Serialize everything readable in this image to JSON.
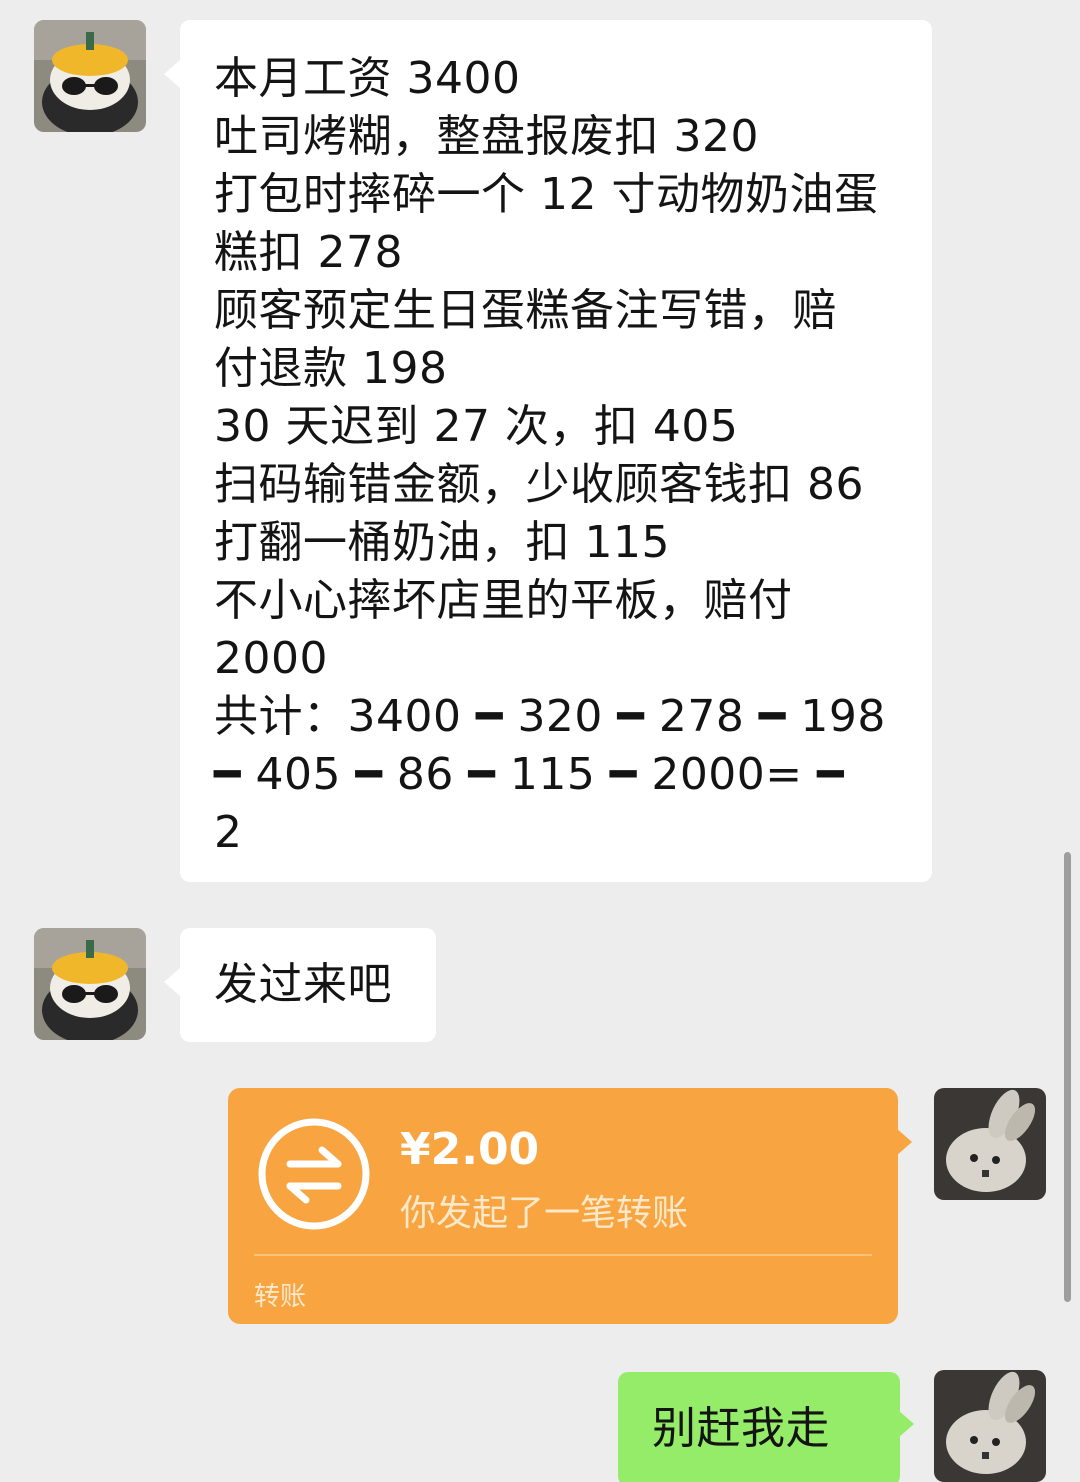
{
  "messages": {
    "first": {
      "lines": [
        "本月工资 3400",
        "吐司烤糊，整盘报废扣 320",
        "打包时摔碎一个 12 寸动物奶油蛋",
        "糕扣 278",
        "顾客预定生日蛋糕备注写错，赔",
        "付退款 198",
        "30 天迟到 27 次，扣 405",
        "扫码输错金额，少收顾客钱扣 86",
        "打翻一桶奶油，扣 115",
        "不小心摔坏店里的平板，赔付",
        "2000",
        "共计：3400 ━ 320 ━ 278 ━ 198",
        "━ 405 ━ 86 ━ 115 ━ 2000= ━",
        "2"
      ]
    },
    "second": {
      "text": "发过来吧"
    },
    "transfer": {
      "amount": "¥2.00",
      "description": "你发起了一笔转账",
      "label": "转账"
    },
    "reply": {
      "text": "别赶我走"
    }
  },
  "colors": {
    "background": "#ededed",
    "incoming_bubble": "#ffffff",
    "transfer_bubble": "#f7a441",
    "outgoing_bubble": "#95ec69"
  },
  "icons": {
    "contact_avatar": "panda-cake-avatar",
    "self_avatar": "plush-bunny-avatar",
    "transfer": "transfer-arrows-icon"
  }
}
